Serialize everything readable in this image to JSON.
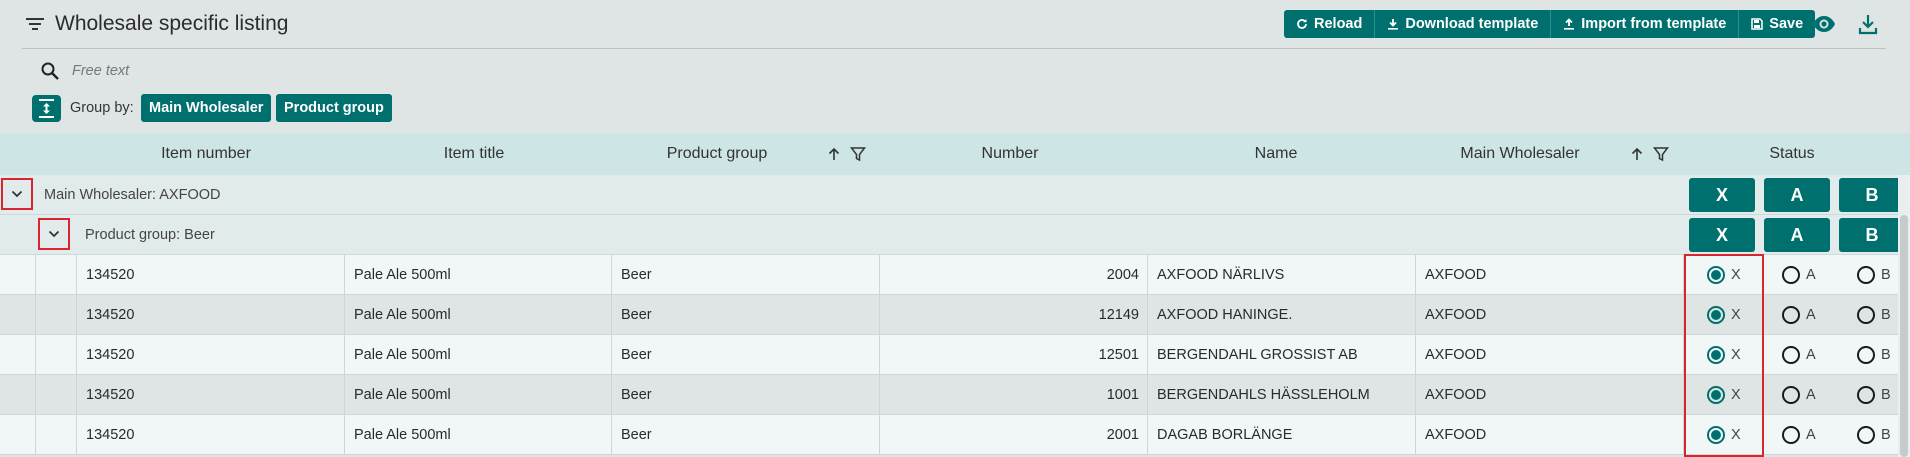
{
  "page": {
    "title": "Wholesale specific listing"
  },
  "toolbar": {
    "buttons": [
      {
        "label": "Reload",
        "icon": "reload-icon"
      },
      {
        "label": "Download template",
        "icon": "download-icon"
      },
      {
        "label": "Import from template",
        "icon": "upload-icon"
      },
      {
        "label": "Save",
        "icon": "save-icon"
      }
    ],
    "right_icons": [
      "eye-icon",
      "download-icon"
    ]
  },
  "search": {
    "placeholder": "Free text",
    "value": ""
  },
  "group_by": {
    "label": "Group by:",
    "chips": [
      "Main Wholesaler",
      "Product group"
    ]
  },
  "table": {
    "columns": [
      "Item number",
      "Item title",
      "Product group",
      "Number",
      "Name",
      "Main Wholesaler",
      "Status"
    ],
    "groups": [
      {
        "text": "Main Wholesaler: AXFOOD",
        "status_buttons": [
          "X",
          "A",
          "B"
        ]
      },
      {
        "text": "Product group: Beer",
        "status_buttons": [
          "X",
          "A",
          "B"
        ]
      }
    ],
    "status_options": [
      "X",
      "A",
      "B"
    ],
    "rows": [
      {
        "item_number": "134520",
        "item_title": "Pale Ale 500ml",
        "product_group": "Beer",
        "number": "2004",
        "name": "AXFOOD NÄRLIVS",
        "main_wholesaler": "AXFOOD",
        "status": "X"
      },
      {
        "item_number": "134520",
        "item_title": "Pale Ale 500ml",
        "product_group": "Beer",
        "number": "12149",
        "name": "AXFOOD HANINGE.",
        "main_wholesaler": "AXFOOD",
        "status": "X"
      },
      {
        "item_number": "134520",
        "item_title": "Pale Ale 500ml",
        "product_group": "Beer",
        "number": "12501",
        "name": "BERGENDAHL GROSSIST AB",
        "main_wholesaler": "AXFOOD",
        "status": "X"
      },
      {
        "item_number": "134520",
        "item_title": "Pale Ale 500ml",
        "product_group": "Beer",
        "number": "1001",
        "name": "BERGENDAHLS HÄSSLEHOLM",
        "main_wholesaler": "AXFOOD",
        "status": "X"
      },
      {
        "item_number": "134520",
        "item_title": "Pale Ale 500ml",
        "product_group": "Beer",
        "number": "2001",
        "name": "DAGAB BORLÄNGE",
        "main_wholesaler": "AXFOOD",
        "status": "X"
      }
    ]
  },
  "colors": {
    "accent": "#00706e",
    "highlight": "#d8262f",
    "header_bg": "#cde5e5"
  }
}
